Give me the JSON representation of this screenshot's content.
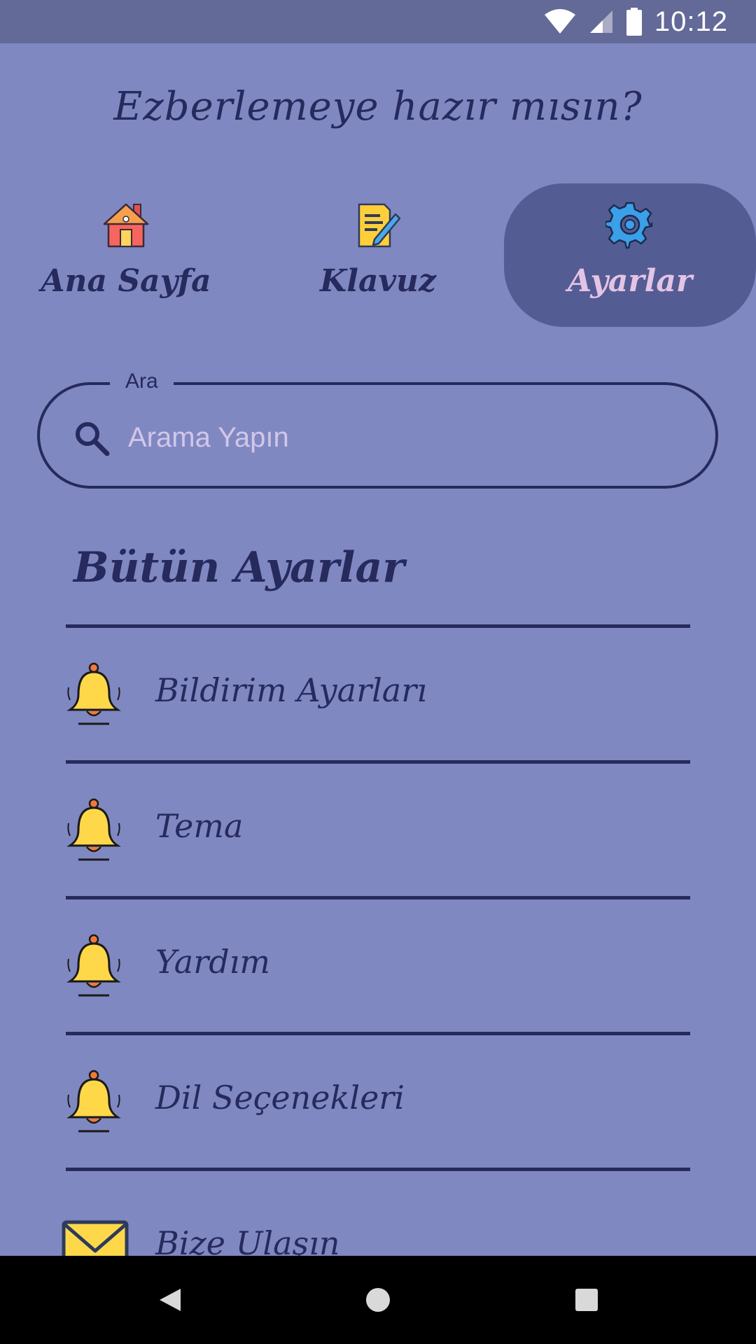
{
  "status_bar": {
    "time": "10:12",
    "icons": [
      "wifi-icon",
      "cellular-signal-icon",
      "battery-icon"
    ]
  },
  "header": {
    "title": "Ezberlemeye hazır mısın?"
  },
  "tabs": [
    {
      "label": "Ana Sayfa",
      "icon": "home-icon",
      "active": false
    },
    {
      "label": "Klavuz",
      "icon": "document-pen-icon",
      "active": false
    },
    {
      "label": "Ayarlar",
      "icon": "gear-icon",
      "active": true
    }
  ],
  "search": {
    "legend": "Ara",
    "placeholder": "Arama Yapın",
    "value": ""
  },
  "settings": {
    "section_title": "Bütün Ayarlar",
    "items": [
      {
        "label": "Bildirim Ayarları",
        "icon": "bell-icon"
      },
      {
        "label": "Tema",
        "icon": "bell-icon"
      },
      {
        "label": "Yardım",
        "icon": "bell-icon"
      },
      {
        "label": "Dil Seçenekleri",
        "icon": "bell-icon"
      },
      {
        "label": "Bize Ulaşın",
        "icon": "envelope-icon"
      }
    ]
  },
  "nav_bar": {
    "buttons": [
      "back-icon",
      "home-circle-icon",
      "recents-icon"
    ]
  },
  "colors": {
    "background": "#8088c2",
    "status_bar": "#636a98",
    "active_tab": "#545c94",
    "text_dark": "#262a5c",
    "active_tab_text": "#e4c4e4",
    "placeholder": "#d2c6e8"
  }
}
